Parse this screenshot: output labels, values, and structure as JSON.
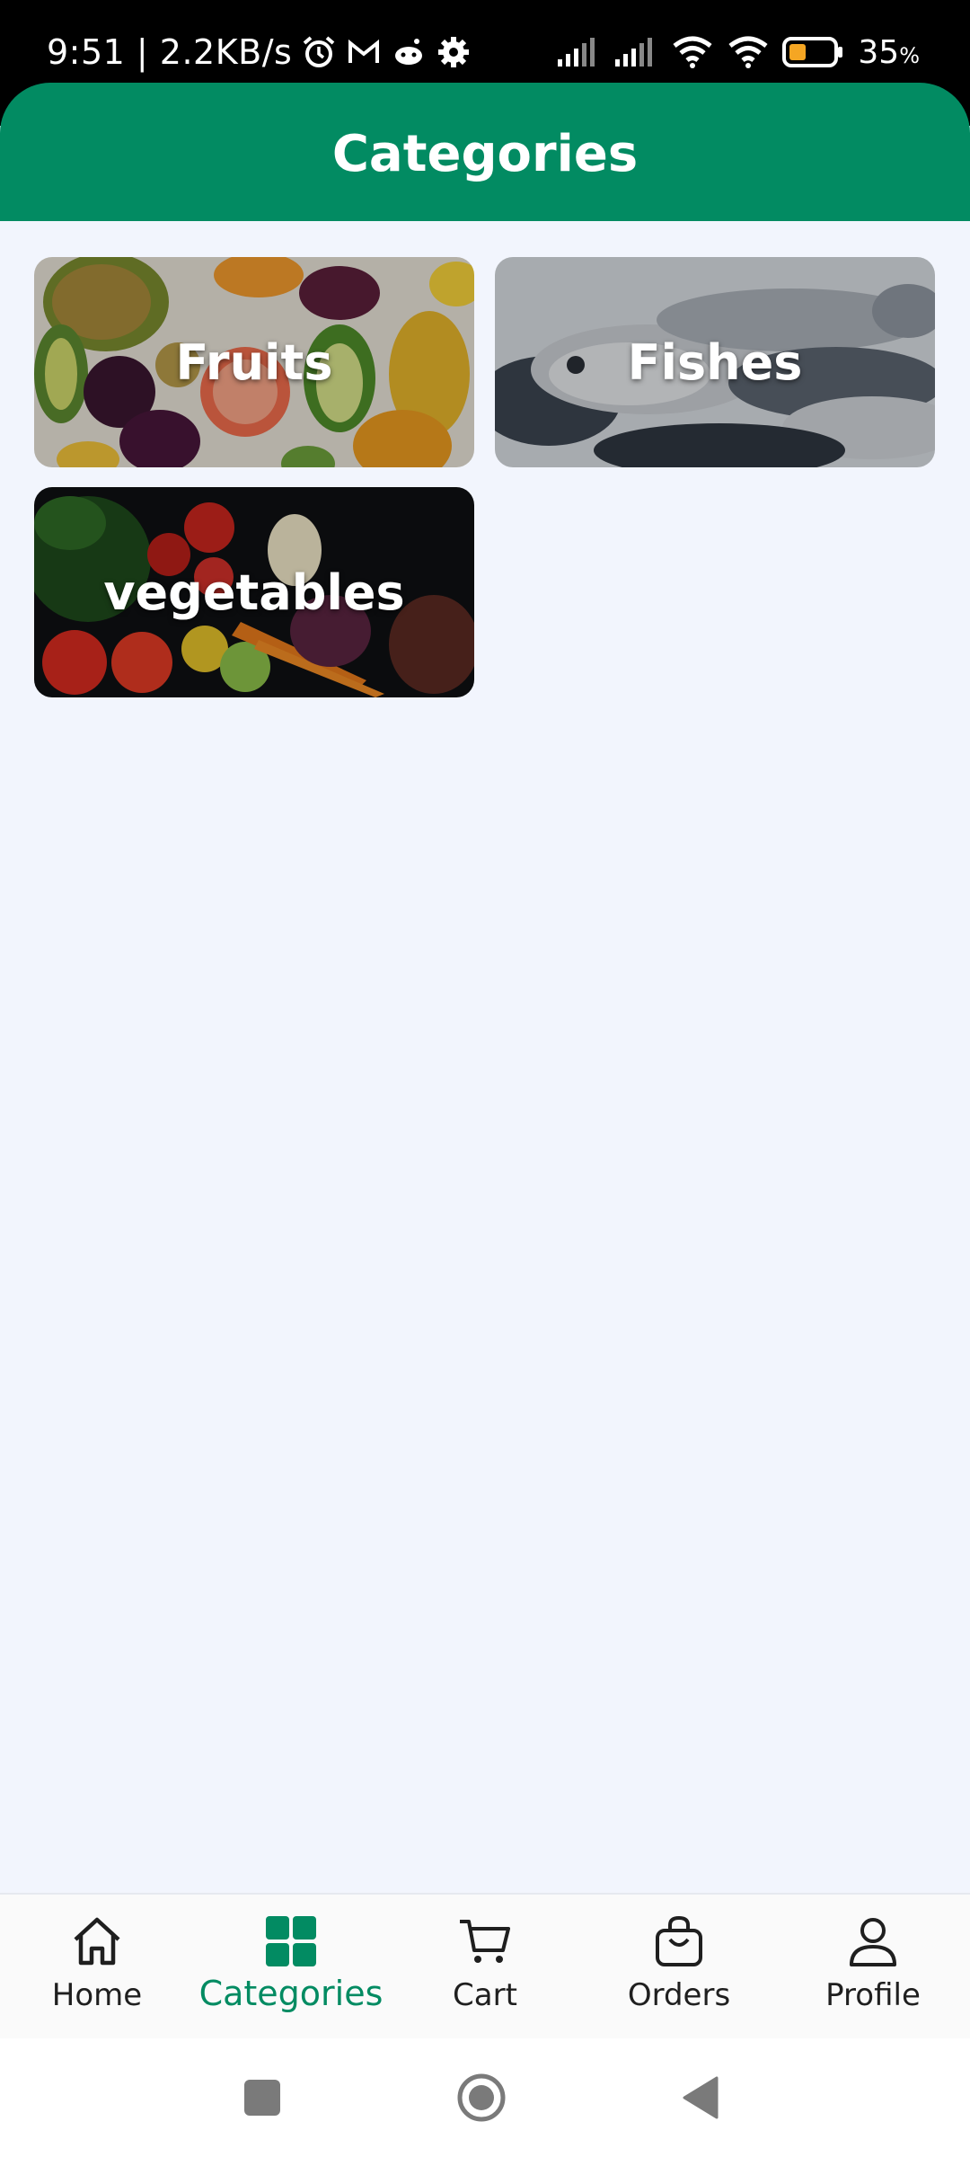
{
  "status_bar": {
    "time_speed": "9:51 | 2.2KB/s",
    "battery": "35",
    "battery_unit": "%",
    "icons": [
      "alarm-icon",
      "gmail-icon",
      "reddit-icon",
      "settings-icon",
      "signal-icon",
      "signal-icon",
      "wifi-icon",
      "wifi-icon",
      "battery-icon"
    ]
  },
  "header": {
    "title": "Categories"
  },
  "categories": [
    {
      "label": "Fruits"
    },
    {
      "label": "Fishes"
    },
    {
      "label": "vegetables"
    }
  ],
  "bottom_nav": {
    "items": [
      {
        "label": "Home",
        "icon": "home-icon"
      },
      {
        "label": "Categories",
        "icon": "grid-icon",
        "active": true
      },
      {
        "label": "Cart",
        "icon": "cart-icon"
      },
      {
        "label": "Orders",
        "icon": "bag-icon"
      },
      {
        "label": "Profile",
        "icon": "person-icon"
      }
    ]
  },
  "colors": {
    "brand": "#028b62",
    "background": "#f2f5fd",
    "nav_bg": "#fafafa"
  },
  "system_nav": [
    "recent-apps-icon",
    "home-circle-icon",
    "back-icon"
  ]
}
